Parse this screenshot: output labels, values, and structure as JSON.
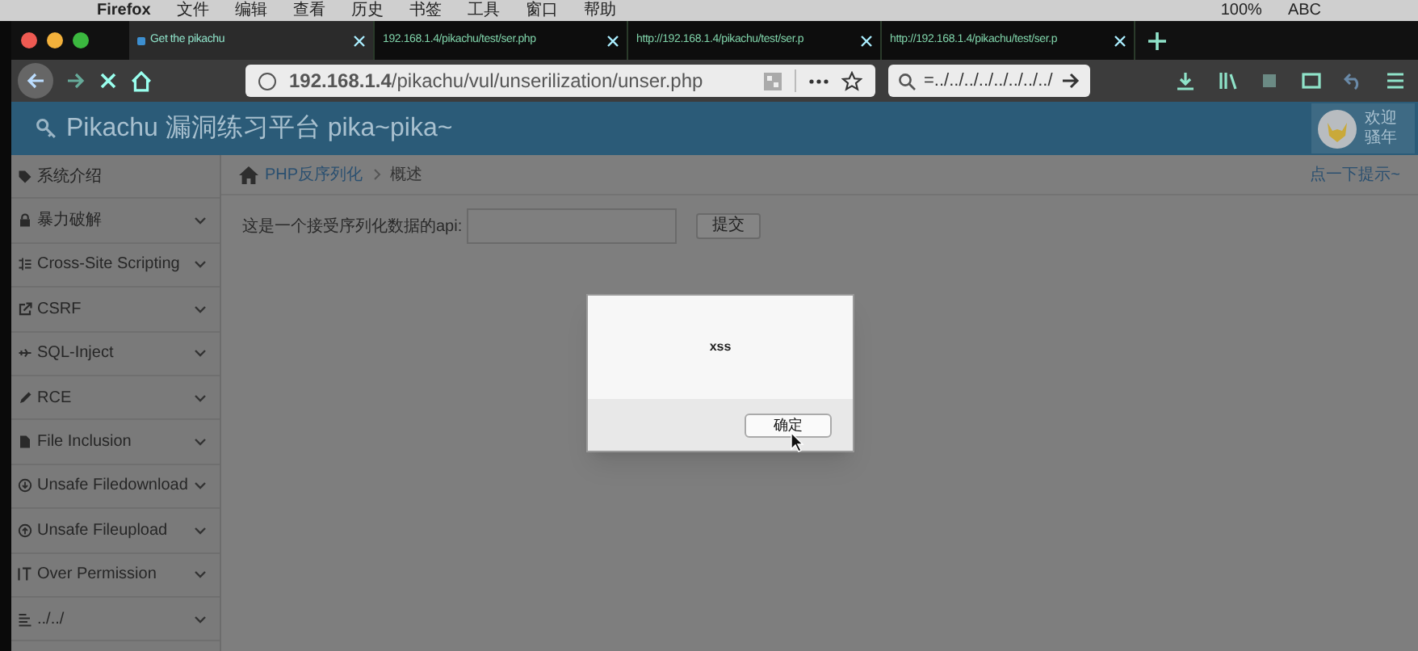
{
  "menu_bar": {
    "items": [
      "Firefox",
      "文件",
      "编辑",
      "查看",
      "历史",
      "书签",
      "工具",
      "窗口",
      "帮助"
    ],
    "status": [
      "100%",
      "ABC"
    ]
  },
  "tabs": [
    {
      "title": "Get the pikachu",
      "selected": true
    },
    {
      "title": "192.168.1.4/pikachu/test/ser.php",
      "selected": false
    },
    {
      "title": "http://192.168.1.4/pikachu/test/ser.p",
      "selected": false
    },
    {
      "title": "http://192.168.1.4/pikachu/test/ser.p",
      "selected": false
    }
  ],
  "address_bar": {
    "url": "**192.168.1.4**/pikachu/vul/unserilization/unser.php"
  },
  "search_field": {
    "value": "=../../../../../../../../"
  },
  "header": {
    "title": "Pikachu 漏洞练习平台 pika~pika~",
    "greeting": [
      "欢迎",
      "骚年"
    ]
  },
  "sidebar": {
    "items": [
      {
        "label": "系统介绍",
        "expandable": false
      },
      {
        "label": "暴力破解",
        "expandable": true
      },
      {
        "label": "Cross-Site Scripting",
        "expandable": true
      },
      {
        "label": "CSRF",
        "expandable": true
      },
      {
        "label": "SQL-Inject",
        "expandable": true
      },
      {
        "label": "RCE",
        "expandable": true
      },
      {
        "label": "File Inclusion",
        "expandable": true
      },
      {
        "label": "Unsafe Filedownload",
        "expandable": true
      },
      {
        "label": "Unsafe Fileupload",
        "expandable": true
      },
      {
        "label": "Over Permission",
        "expandable": true
      },
      {
        "label": "../../",
        "expandable": true
      }
    ]
  },
  "breadcrumb": [
    "PHP反序列化",
    "概述"
  ],
  "hint_link": "点一下提示~",
  "form": {
    "label": "这是一个接受序列化数据的api:",
    "button": "提交"
  },
  "dialog": {
    "message": "xss",
    "button": "确定"
  }
}
